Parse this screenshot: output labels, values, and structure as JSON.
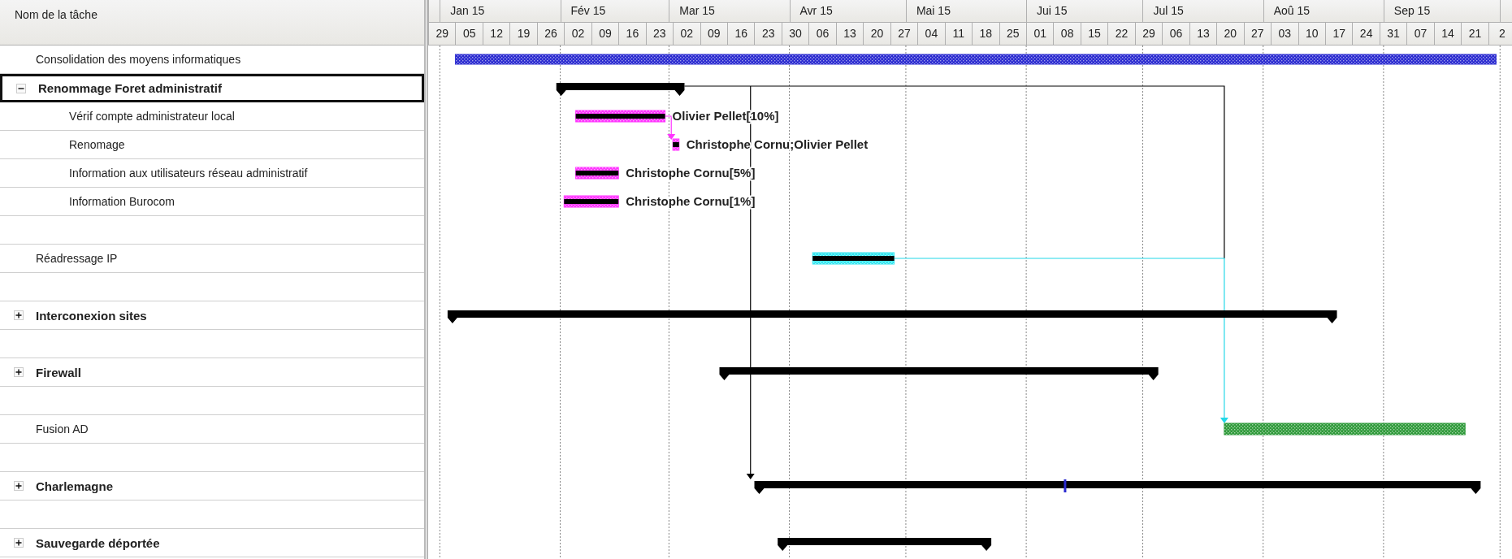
{
  "task_table": {
    "column_header": "Nom de la tâche",
    "rows": [
      {
        "kind": "task",
        "name": "Consolidation des moyens informatiques",
        "selected": false,
        "bar": {
          "kind": "task",
          "color": "#2a2ad0",
          "progress_line": false
        }
      },
      {
        "kind": "summary",
        "name": "Renommage Foret administratif",
        "selected": true,
        "expanded": true,
        "bar": {
          "kind": "summary"
        },
        "children": [
          {
            "kind": "task",
            "name": "Vérif compte administrateur local",
            "selected": false,
            "bar": {
              "kind": "task",
              "color": "#ff33ff",
              "progress_line": true,
              "label": "Olivier Pellet[10%]"
            }
          },
          {
            "kind": "task",
            "name": "Renomage",
            "selected": false,
            "bar": {
              "kind": "task",
              "color": "#ff33ff",
              "progress_line": true,
              "label": "Christophe Cornu;Olivier Pellet"
            }
          },
          {
            "kind": "task",
            "name": "Information aux utilisateurs réseau administratif",
            "selected": false,
            "bar": {
              "kind": "task",
              "color": "#ff33ff",
              "progress_line": true,
              "label": "Christophe Cornu[5%]"
            }
          },
          {
            "kind": "task",
            "name": "Information Burocom",
            "selected": false,
            "bar": {
              "kind": "task",
              "color": "#ff33ff",
              "progress_line": true,
              "label": "Christophe Cornu[1%]"
            }
          }
        ]
      },
      {
        "kind": "blank",
        "selected": false
      },
      {
        "kind": "task",
        "name": "Réadressage IP",
        "selected": false,
        "bar": {
          "kind": "task",
          "color": "#33e6f0",
          "progress_line": true
        }
      },
      {
        "kind": "blank",
        "selected": false
      },
      {
        "kind": "summary",
        "name": "Interconexion sites",
        "selected": false,
        "expanded": false,
        "bar": {
          "kind": "summary"
        }
      },
      {
        "kind": "blank",
        "selected": false
      },
      {
        "kind": "summary",
        "name": "Firewall",
        "selected": false,
        "expanded": false,
        "bar": {
          "kind": "summary"
        }
      },
      {
        "kind": "blank",
        "selected": false
      },
      {
        "kind": "task",
        "name": "Fusion AD",
        "selected": false,
        "bar": {
          "kind": "task",
          "color": "#2f9a3a",
          "progress_line": false
        }
      },
      {
        "kind": "blank",
        "selected": false
      },
      {
        "kind": "summary",
        "name": "Charlemagne",
        "selected": false,
        "expanded": false,
        "bar": {
          "kind": "summary",
          "deadline_marker": true
        }
      },
      {
        "kind": "blank",
        "selected": false
      },
      {
        "kind": "summary",
        "name": "Sauvegarde déportée",
        "selected": false,
        "expanded": false,
        "bar": {
          "kind": "summary"
        }
      }
    ]
  },
  "timeline": {
    "months": [
      "Jan 15",
      "Fév 15",
      "Mar 15",
      "Avr 15",
      "Mai 15",
      "Jui 15",
      "Jul 15",
      "Aoû 15",
      "Sep 15"
    ],
    "weeks": [
      "29",
      "05",
      "12",
      "19",
      "26",
      "02",
      "09",
      "16",
      "23",
      "02",
      "09",
      "16",
      "23",
      "30",
      "06",
      "13",
      "20",
      "27",
      "04",
      "11",
      "18",
      "25",
      "01",
      "08",
      "15",
      "22",
      "29",
      "06",
      "13",
      "20",
      "27",
      "03",
      "10",
      "17",
      "24",
      "31",
      "07",
      "14",
      "21",
      "2"
    ]
  }
}
